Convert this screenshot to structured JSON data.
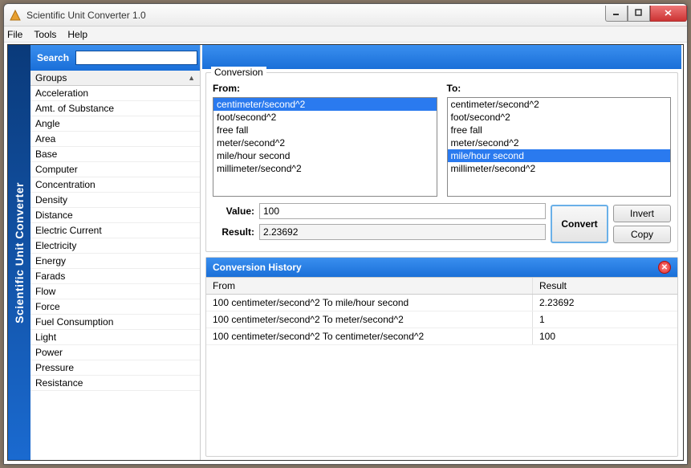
{
  "window": {
    "title": "Scientific Unit Converter 1.0"
  },
  "menu": {
    "file": "File",
    "tools": "Tools",
    "help": "Help"
  },
  "sidebar": {
    "vertical_label": "Scientific Unit Converter"
  },
  "search": {
    "label": "Search",
    "value": ""
  },
  "groups": {
    "header": "Groups",
    "items": [
      "Acceleration",
      "Amt. of Substance",
      "Angle",
      "Area",
      "Base",
      "Computer",
      "Concentration",
      "Density",
      "Distance",
      "Electric Current",
      "Electricity",
      "Energy",
      "Farads",
      "Flow",
      "Force",
      "Fuel Consumption",
      "Light",
      "Power",
      "Pressure",
      "Resistance"
    ]
  },
  "conversion": {
    "legend": "Conversion",
    "from_label": "From:",
    "to_label": "To:",
    "from_list": [
      "centimeter/second^2",
      "foot/second^2",
      "free fall",
      "meter/second^2",
      "mile/hour second",
      "millimeter/second^2"
    ],
    "from_selected": 0,
    "to_list": [
      "centimeter/second^2",
      "foot/second^2",
      "free fall",
      "meter/second^2",
      "mile/hour second",
      "millimeter/second^2"
    ],
    "to_selected": 4,
    "value_label": "Value:",
    "value": "100",
    "result_label": "Result:",
    "result": "2.23692",
    "convert_btn": "Convert",
    "invert_btn": "Invert",
    "copy_btn": "Copy"
  },
  "history": {
    "title": "Conversion History",
    "col_from": "From",
    "col_result": "Result",
    "rows": [
      {
        "from": "100 centimeter/second^2 To mile/hour second",
        "result": "2.23692"
      },
      {
        "from": "100 centimeter/second^2 To meter/second^2",
        "result": "1"
      },
      {
        "from": "100 centimeter/second^2 To centimeter/second^2",
        "result": "100"
      }
    ]
  }
}
